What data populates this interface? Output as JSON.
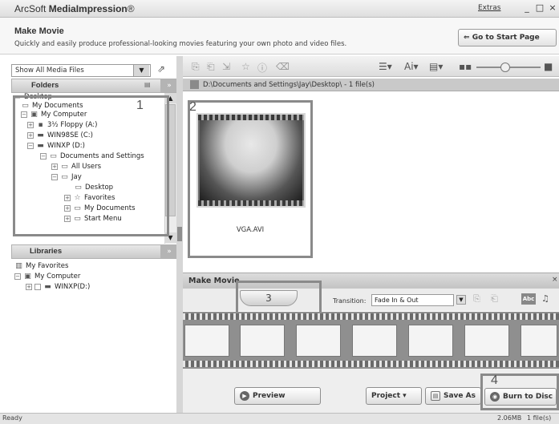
{
  "window": {
    "title_prefix": "ArcSoft",
    "title_brand": "MediaImpression",
    "title_mark": "®",
    "extras_label": "Extras",
    "minimize": "_",
    "restore": "□",
    "close": "×"
  },
  "header": {
    "title": "Make Movie",
    "subtitle": "Quickly and easily produce professional-looking movies featuring your own photo and video files.",
    "start_page_button": "Go to Start Page",
    "start_page_icon": "⇐"
  },
  "left_panel": {
    "media_filter": "Show All Media Files",
    "folders_title": "Folders",
    "libraries_title": "Libraries",
    "tree": [
      {
        "label": "Desktop",
        "indent": 0,
        "icon": "folder-icon"
      },
      {
        "label": "My Documents",
        "indent": 1,
        "icon": "folder-icon"
      },
      {
        "label": "My Computer",
        "indent": 1,
        "icon": "computer-icon"
      },
      {
        "label": "3½ Floppy (A:)",
        "indent": 2,
        "icon": "floppy-icon"
      },
      {
        "label": "WIN98SE (C:)",
        "indent": 2,
        "icon": "drive-icon"
      },
      {
        "label": "WINXP (D:)",
        "indent": 2,
        "icon": "drive-icon"
      },
      {
        "label": "Documents and Settings",
        "indent": 3,
        "icon": "folder-icon"
      },
      {
        "label": "All Users",
        "indent": 4,
        "icon": "folder-icon"
      },
      {
        "label": "Jay",
        "indent": 4,
        "icon": "folder-icon"
      },
      {
        "label": "Desktop",
        "indent": 5,
        "icon": "folder-icon"
      },
      {
        "label": "Favorites",
        "indent": 5,
        "icon": "favorites-icon"
      },
      {
        "label": "My Documents",
        "indent": 5,
        "icon": "folder-icon"
      },
      {
        "label": "Start Menu",
        "indent": 5,
        "icon": "folder-icon"
      }
    ],
    "libraries": [
      {
        "label": "My Favorites"
      },
      {
        "label": "My Computer"
      },
      {
        "label": "WINXP(D:)"
      }
    ]
  },
  "callouts": {
    "one": "1",
    "two": "2",
    "three": "3",
    "four": "4"
  },
  "browser": {
    "path": "D:\\Documents and Settings\\Jay\\Desktop\\ - 1 file(s)",
    "item_name": "VGA.AVI"
  },
  "movie": {
    "title": "Make Movie",
    "close": "×",
    "tab_label": "3",
    "transition_label": "Transition:",
    "transition_value": "Fade In & Out",
    "abc_label": "Abc",
    "preview_button": "Preview",
    "project_button": "Project ▾",
    "save_as_button": "Save As",
    "burn_button": "Burn to Disc"
  },
  "status": {
    "text": "Ready",
    "size": "2.06MB",
    "files": "1 file(s)"
  },
  "colors": {
    "callout_border": "#8a8a8a",
    "panel_header": "#c9c9c9",
    "filmstrip": "#8f8f8f"
  }
}
